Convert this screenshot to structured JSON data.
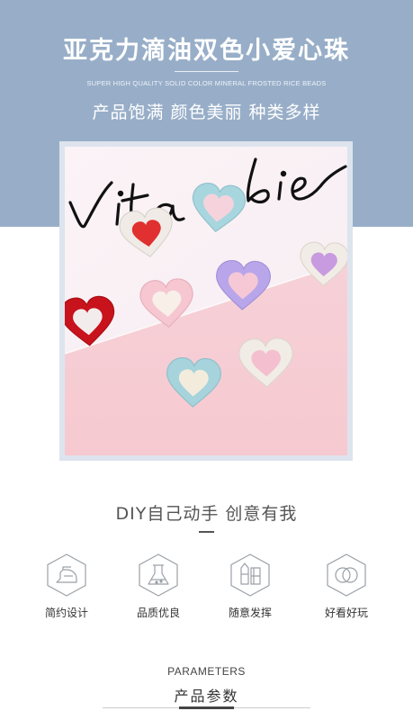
{
  "header": {
    "title": "亚克力滴油双色小爱心珠",
    "subtitle_en": "SUPER HIGH QUALITY SOLID COLOR MINERAL FROSTED RICE BEADS",
    "subtitle_cn": "产品饱满 颜色美丽 种类多样",
    "background_color": "#98aec8"
  },
  "photo": {
    "card_script_text": "Vita bie",
    "beads": [
      {
        "outer": "#f0ebe6",
        "inner": "#e0302f"
      },
      {
        "outer": "#a7d6df",
        "inner": "#f6d3dc"
      },
      {
        "outer": "#f1ede6",
        "inner": "#c89be0"
      },
      {
        "outer": "#c8121c",
        "inner": "#f3ecec"
      },
      {
        "outer": "#f6c6d1",
        "inner": "#f7efe8"
      },
      {
        "outer": "#b9a6ea",
        "inner": "#f6c8d6"
      },
      {
        "outer": "#f1ece6",
        "inner": "#f4bfcf"
      },
      {
        "outer": "#a6d3dc",
        "inner": "#f3ecdd"
      }
    ]
  },
  "tagline": {
    "text": "DIY自己动手 创意有我"
  },
  "features": [
    {
      "icon": "iron-icon",
      "label": "简约设计"
    },
    {
      "icon": "flask-icon",
      "label": "品质优良"
    },
    {
      "icon": "palette-icon",
      "label": "随意发挥"
    },
    {
      "icon": "rings-icon",
      "label": "好看好玩"
    }
  ],
  "params": {
    "title_en": "PARAMETERS",
    "title_cn": "产品参数"
  }
}
